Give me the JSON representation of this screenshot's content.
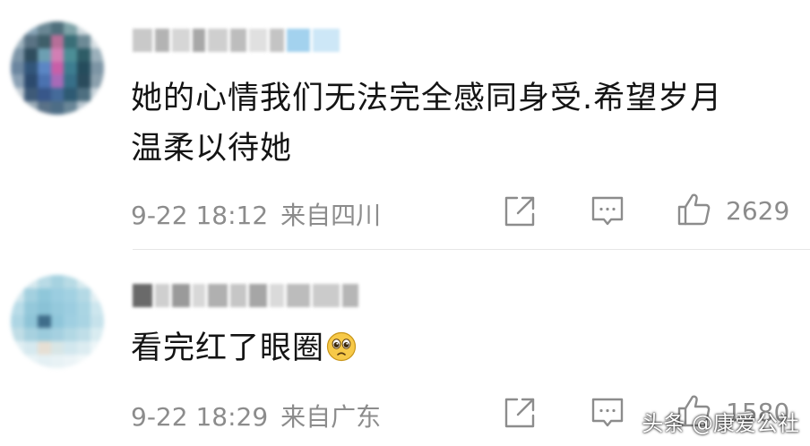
{
  "comments": [
    {
      "text_line1": "她的心情我们无法完全感同身受.希望岁月",
      "text_line2": "温柔以待她",
      "date": "9-22 18:12",
      "location": "来自四川",
      "likes": "2629",
      "username_blocks": [
        "#c9c9c9",
        "#b3b3b3",
        "#d6d6d6",
        "#a8a8a8",
        "#cfcfcf",
        "#bdbdbd",
        "#e0e0e0",
        "#c4c4c4",
        "#a3d2ee",
        "#cde7f7"
      ],
      "avatar_pixels": [
        "#f2f2f2",
        "#8aa6b8",
        "#6a8794",
        "#4f6f7c",
        "#7fa3a8",
        "#cfd9de",
        "#f6f6f6",
        "#9fb3bf",
        "#5a7384",
        "#3f5f6a",
        "#b66f98",
        "#3a6e77",
        "#6d8a96",
        "#d8e0e4",
        "#7d96a8",
        "#2f4d5e",
        "#6d9fb2",
        "#d27fb4",
        "#4c8e96",
        "#2e5c66",
        "#9bb0bb",
        "#6b86a0",
        "#32557a",
        "#5b86c4",
        "#c85fa8",
        "#3d7d90",
        "#254c5c",
        "#7d95a5",
        "#8aa0b4",
        "#2c4a6e",
        "#4b72b0",
        "#a86ab8",
        "#376f88",
        "#2a4b5c",
        "#8ba0ad",
        "#c2ccd4",
        "#3e5a78",
        "#38578a",
        "#456b9a",
        "#2e5a73",
        "#4e6f80",
        "#c8d3da",
        "#f2f4f5",
        "#9aaab6",
        "#5a7288",
        "#4d6d86",
        "#6a8798",
        "#b9c6cf",
        "#f5f5f5"
      ]
    },
    {
      "text": "看完红了眼圈",
      "date": "9-22 18:29",
      "location": "来自广东",
      "likes": "1580",
      "username_blocks": [
        "#6a6a6a",
        "#cfcfcf",
        "#9a9a9a",
        "#d8d8d8",
        "#b0b0b0",
        "#c6c6c6",
        "#a6a6a6",
        "#dadada",
        "#bcbcbc",
        "#cbcbcb",
        "#b6b6b6"
      ],
      "avatar_pixels": [
        "#f7f9fa",
        "#d5e8ee",
        "#b9dbe6",
        "#a6d2e0",
        "#b8dbe5",
        "#d7eaef",
        "#f7f9fa",
        "#d2e7ee",
        "#a3d0df",
        "#8fc7da",
        "#9bcde0",
        "#a2d1e2",
        "#b4d9e5",
        "#e2eff3",
        "#b9dce8",
        "#94c8da",
        "#8ac2d6",
        "#95c9dc",
        "#9ccde0",
        "#aad5e3",
        "#cde6ee",
        "#aed6e4",
        "#8ec4d7",
        "#3f6d8a",
        "#8fc6da",
        "#9fcfe1",
        "#a9d4e3",
        "#c6e2eb",
        "#c0dde6",
        "#a7d1df",
        "#9bcbdc",
        "#a5d0e0",
        "#b2d8e4",
        "#bfdee8",
        "#d9ecf1",
        "#e1eff3",
        "#d6e9ef",
        "#e6dfd4",
        "#d8e6e6",
        "#d2e7ee",
        "#dcecf1",
        "#eef6f8",
        "#fafbfb",
        "#e9f3f6",
        "#e4f0f4",
        "#e8f2f5",
        "#ecf4f7",
        "#f2f8f9",
        "#fbfcfc"
      ]
    }
  ],
  "icons": {
    "share": "share-icon",
    "reply": "comment-icon",
    "like": "thumbs-up-icon",
    "emoji": "teary-eyes-emoji-icon"
  },
  "watermark": "头条 @康爱公社",
  "colors": {
    "text_primary": "#141414",
    "text_meta": "#8c8c8c",
    "divider": "#e6e6e6",
    "emoji_face": "#f7c948"
  }
}
